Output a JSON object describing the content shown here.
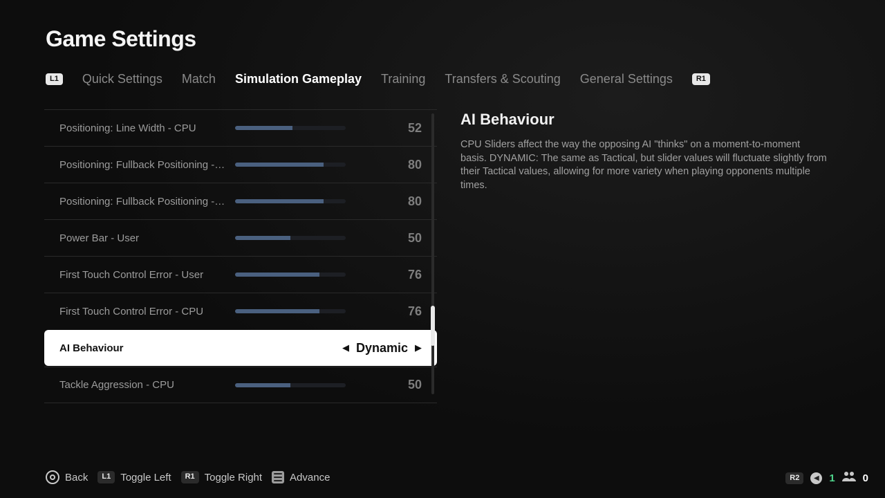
{
  "title": "Game Settings",
  "tabs": [
    {
      "label": "Quick Settings",
      "active": false
    },
    {
      "label": "Match",
      "active": false
    },
    {
      "label": "Simulation Gameplay",
      "active": true
    },
    {
      "label": "Training",
      "active": false
    },
    {
      "label": "Transfers & Scouting",
      "active": false
    },
    {
      "label": "General Settings",
      "active": false
    }
  ],
  "shoulder_left": "L1",
  "shoulder_right": "R1",
  "rows": [
    {
      "label": "Positioning: Line Width - CPU",
      "value": 52,
      "percent": 52,
      "type": "slider"
    },
    {
      "label": "Positioning: Fullback Positioning - ...",
      "value": 80,
      "percent": 80,
      "type": "slider"
    },
    {
      "label": "Positioning: Fullback Positioning - ...",
      "value": 80,
      "percent": 80,
      "type": "slider"
    },
    {
      "label": "Power Bar - User",
      "value": 50,
      "percent": 50,
      "type": "slider"
    },
    {
      "label": "First Touch Control Error - User",
      "value": 76,
      "percent": 76,
      "type": "slider"
    },
    {
      "label": "First Touch Control Error - CPU",
      "value": 76,
      "percent": 76,
      "type": "slider"
    },
    {
      "label": "AI Behaviour",
      "value": "Dynamic",
      "type": "select",
      "selected": true
    },
    {
      "label": "Tackle Aggression - CPU",
      "value": 50,
      "percent": 50,
      "type": "slider"
    }
  ],
  "desc": {
    "title": "AI Behaviour",
    "body": "CPU Sliders affect the way the opposing AI \"thinks\" on a moment-to-moment basis. DYNAMIC: The same as Tactical, but slider values will fluctuate slightly from their Tactical values, allowing for more variety when playing opponents multiple times."
  },
  "footer": {
    "back": "Back",
    "toggle_left_badge": "L1",
    "toggle_left": "Toggle Left",
    "toggle_right_badge": "R1",
    "toggle_right": "Toggle Right",
    "advance": "Advance"
  },
  "footer_right": {
    "badge": "R2",
    "online": 1,
    "party": 0
  }
}
